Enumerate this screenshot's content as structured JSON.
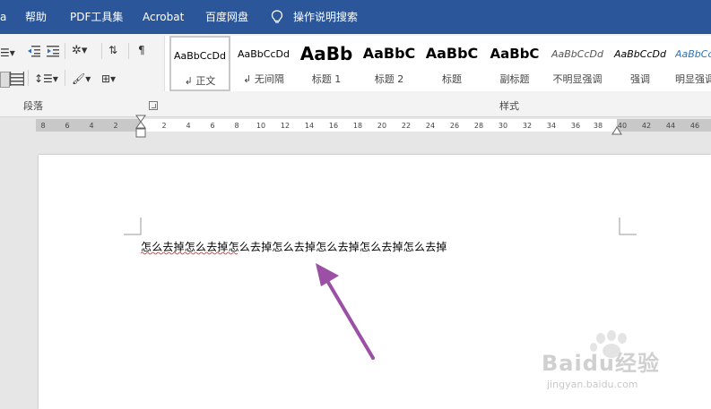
{
  "menubar": {
    "items": [
      "帮助",
      "PDF工具集",
      "Acrobat",
      "百度网盘",
      "操作说明搜索"
    ],
    "left_fragment": "a",
    "background": "#2b579a"
  },
  "ribbon": {
    "group_paragraph": "段落",
    "group_styles": "样式",
    "styles": [
      {
        "sample": "AaBbCcDd",
        "name": "↲ 正文",
        "selected": true
      },
      {
        "sample": "AaBbCcDd",
        "name": "↲ 无间隔"
      },
      {
        "sample": "AaBb",
        "name": "标题 1"
      },
      {
        "sample": "AaBbC",
        "name": "标题 2"
      },
      {
        "sample": "AaBbC",
        "name": "标题"
      },
      {
        "sample": "AaBbC",
        "name": "副标题"
      },
      {
        "sample": "AaBbCcDd",
        "name": "不明显强调"
      },
      {
        "sample": "AaBbCcDd",
        "name": "强调"
      },
      {
        "sample": "AaBbCcDd",
        "name": "明显强调"
      }
    ]
  },
  "ruler": {
    "left_numbers": [
      "8",
      "6",
      "4",
      "2"
    ],
    "right_numbers": [
      "2",
      "4",
      "6",
      "8",
      "10",
      "12",
      "14",
      "16",
      "18",
      "20",
      "22",
      "24",
      "26",
      "28",
      "30",
      "32",
      "34",
      "36",
      "38",
      "40",
      "42",
      "44",
      "46"
    ]
  },
  "document": {
    "text": "怎么去掉怎么去掉怎么去掉怎么去掉怎么去掉怎么去掉怎么去掉"
  },
  "annotation": {
    "arrow_color": "#9b4fa5"
  },
  "watermark": {
    "logo": "Baidu经验",
    "url": "jingyan.baidu.com"
  }
}
